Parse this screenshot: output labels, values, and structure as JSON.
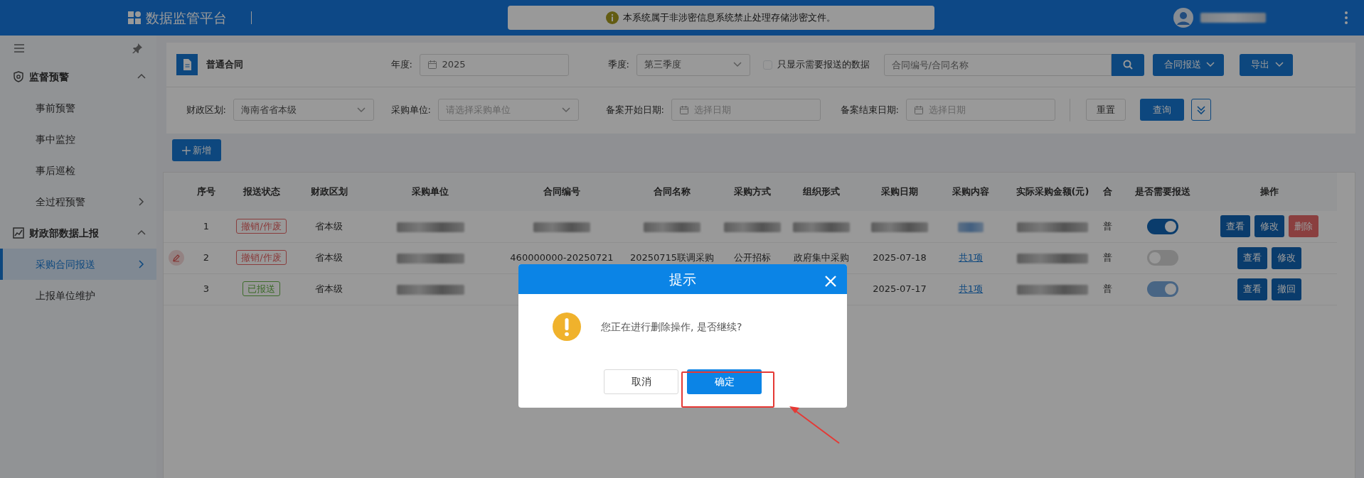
{
  "header": {
    "title": "数据监管平台",
    "notice": "本系统属于非涉密信息系统禁止处理存储涉密文件。",
    "user_redacted": true
  },
  "sidebar": {
    "items": [
      {
        "label": "监督预警",
        "kind": "group",
        "expanded": true,
        "children": [
          {
            "label": "事前预警",
            "selected": false,
            "has_submenu": false
          },
          {
            "label": "事中监控",
            "selected": false,
            "has_submenu": false
          },
          {
            "label": "事后巡检",
            "selected": false,
            "has_submenu": false
          },
          {
            "label": "全过程预警",
            "selected": false,
            "has_submenu": true
          }
        ]
      },
      {
        "label": "财政部数据上报",
        "kind": "group",
        "expanded": true,
        "children": [
          {
            "label": "采购合同报送",
            "selected": true,
            "has_submenu": true
          },
          {
            "label": "上报单位维护",
            "selected": false,
            "has_submenu": false
          }
        ]
      }
    ]
  },
  "filters": {
    "title": "普通合同",
    "year": {
      "label": "年度:",
      "value": "2025"
    },
    "quarter": {
      "label": "季度:",
      "value": "第三季度"
    },
    "only_needed": {
      "label": "只显示需要报送的数据",
      "checked": false
    },
    "search": {
      "placeholder": "合同编号/合同名称"
    },
    "menu_buttons": [
      "合同报送",
      "导出"
    ],
    "region": {
      "label": "财政区划:",
      "value": "海南省省本级"
    },
    "unit": {
      "label": "采购单位:",
      "placeholder": "请选择采购单位"
    },
    "start_date": {
      "label": "备案开始日期:",
      "placeholder": "选择日期"
    },
    "end_date": {
      "label": "备案结束日期:",
      "placeholder": "选择日期"
    },
    "reset": "重置",
    "query": "查询"
  },
  "add_button": "新增",
  "table": {
    "columns": [
      "序号",
      "报送状态",
      "财政区划",
      "采购单位",
      "合同编号",
      "合同名称",
      "采购方式",
      "组织形式",
      "采购日期",
      "采购内容",
      "实际采购金额(元)",
      "合",
      "是否需要报送",
      "操作"
    ],
    "rows": [
      {
        "editing": false,
        "cells": [
          "1",
          {
            "kind": "tag",
            "text": "撤销/作废",
            "color": "#8a3d3d"
          },
          "省本级",
          {
            "kind": "redacted"
          },
          {
            "kind": "redacted"
          },
          {
            "kind": "redacted"
          },
          {
            "kind": "redacted"
          },
          {
            "kind": "redacted"
          },
          {
            "kind": "redacted"
          },
          {
            "kind": "redacted_link"
          },
          {
            "kind": "redacted"
          },
          "普",
          {
            "kind": "toggle",
            "on": true,
            "disabled": false
          },
          {
            "kind": "actions",
            "buttons": [
              {
                "label": "查看",
                "kind": "primary"
              },
              {
                "label": "修改",
                "kind": "primary"
              },
              {
                "label": "删除",
                "kind": "danger"
              }
            ]
          }
        ]
      },
      {
        "editing": true,
        "cells": [
          "2",
          {
            "kind": "tag",
            "text": "撤销/作废",
            "color": "#8a3d3d"
          },
          "省本级",
          {
            "kind": "redacted"
          },
          "460000000-20250721",
          "20250715联调采购",
          "公开招标",
          "政府集中采购",
          "2025-07-18",
          {
            "kind": "link",
            "text": "共1项"
          },
          {
            "kind": "redacted"
          },
          "普",
          {
            "kind": "toggle",
            "on": false,
            "disabled": false
          },
          {
            "kind": "actions",
            "buttons": [
              {
                "label": "查看",
                "kind": "primary"
              },
              {
                "label": "修改",
                "kind": "primary"
              }
            ]
          }
        ]
      },
      {
        "editing": false,
        "cells": [
          "3",
          {
            "kind": "tag",
            "text": "已报送",
            "color": "#3e6b2c"
          },
          "省本级",
          {
            "kind": "redacted"
          },
          null,
          null,
          null,
          null,
          "2025-07-17",
          {
            "kind": "link",
            "text": "共1项"
          },
          {
            "kind": "redacted"
          },
          "普",
          {
            "kind": "toggle",
            "on": true,
            "disabled": true
          },
          {
            "kind": "actions",
            "buttons": [
              {
                "label": "查看",
                "kind": "primary"
              },
              {
                "label": "撤回",
                "kind": "primary"
              }
            ]
          }
        ]
      }
    ]
  },
  "dialog": {
    "title": "提示",
    "message": "您正在进行删除操作, 是否继续?",
    "cancel": "取消",
    "confirm": "确定",
    "confirm_highlighted": true
  }
}
